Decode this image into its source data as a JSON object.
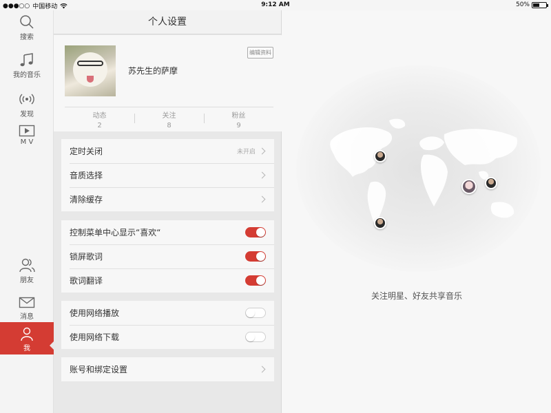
{
  "status_bar": {
    "signal": "●●●○○",
    "carrier": "中国移动",
    "wifi_icon": "wifi-icon",
    "time": "9:12 AM",
    "battery_text": "50%",
    "battery_level": 0.5
  },
  "nav": {
    "items": [
      {
        "label": "搜索",
        "icon": "search-icon"
      },
      {
        "label": "我的音乐",
        "icon": "music-note-icon"
      },
      {
        "label": "发现",
        "icon": "broadcast-icon"
      },
      {
        "label": "M V",
        "icon": "play-icon"
      },
      {
        "label": "朋友",
        "icon": "friends-icon"
      },
      {
        "label": "消息",
        "icon": "mail-icon"
      },
      {
        "label": "我",
        "icon": "user-icon"
      }
    ],
    "active_index": 6,
    "active_color": "#d43c33"
  },
  "panel": {
    "title": "个人设置",
    "profile": {
      "name": "苏先生的萨摩",
      "edit_label": "编辑资料",
      "stats": [
        {
          "label": "动态",
          "value": "2"
        },
        {
          "label": "关注",
          "value": "8"
        },
        {
          "label": "粉丝",
          "value": "9"
        }
      ]
    },
    "group1": [
      {
        "label": "定时关闭",
        "value": "未开启"
      },
      {
        "label": "音质选择"
      },
      {
        "label": "清除缓存"
      }
    ],
    "group2": [
      {
        "label": "控制菜单中心显示“喜欢“",
        "on": true
      },
      {
        "label": "锁屏歌词",
        "on": true
      },
      {
        "label": "歌词翻译",
        "on": true
      }
    ],
    "group3": [
      {
        "label": "使用网络播放",
        "on": false
      },
      {
        "label": "使用网络下载",
        "on": false
      }
    ],
    "group4": [
      {
        "label": "账号和绑定设置"
      }
    ]
  },
  "map": {
    "caption": "关注明星、好友共享音乐"
  }
}
